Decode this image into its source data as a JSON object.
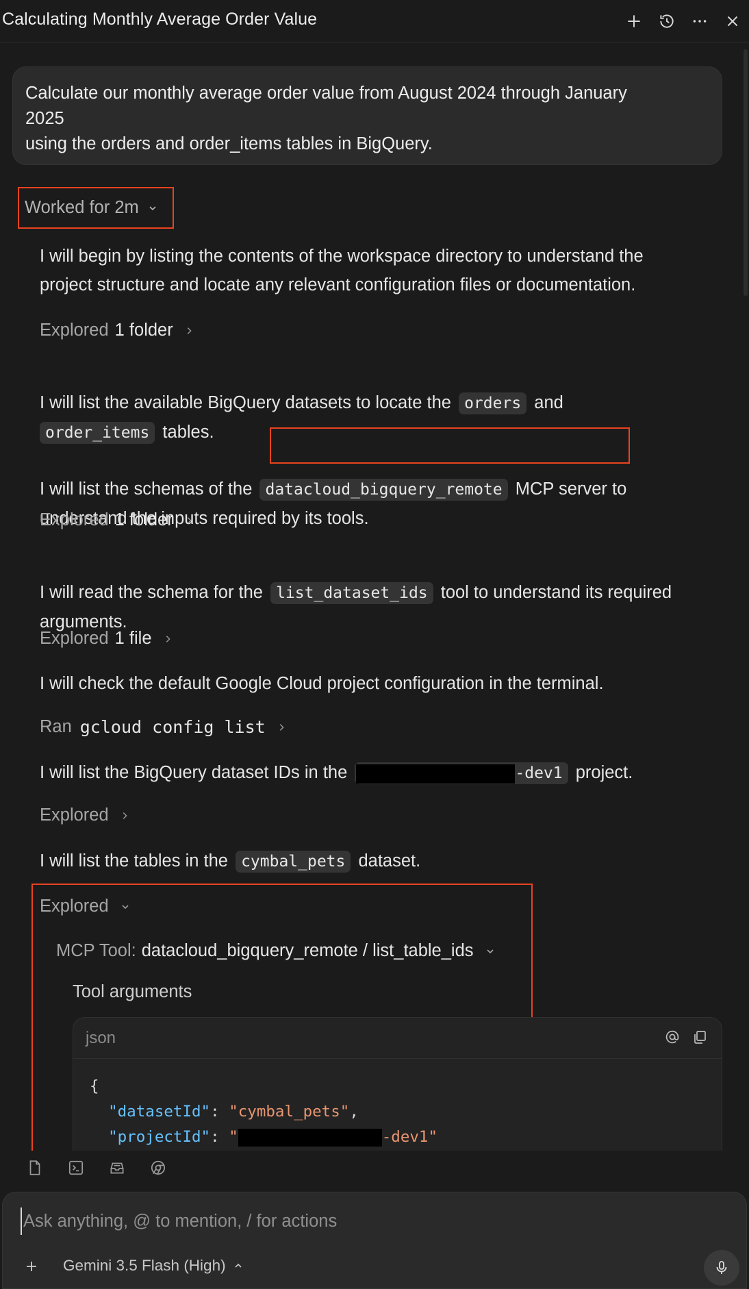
{
  "header": {
    "title": "Calculating Monthly Average Order Value",
    "actions": [
      "plus-icon",
      "history-icon",
      "more-icon",
      "close-icon"
    ]
  },
  "user_message": {
    "line1": "Calculate our monthly average order value from August 2024 through January",
    "line2": "2025",
    "line3": "using the orders and order_items tables in BigQuery."
  },
  "worked": {
    "label": "Worked for 2m"
  },
  "steps": {
    "p1_line1": "I will begin by listing the contents of the workspace directory to understand the",
    "p1_line2": "project structure and locate any relevant configuration files or documentation.",
    "explored1_label": "Explored",
    "explored1_value": "1 folder",
    "p2_pre": "I will list the available BigQuery datasets to locate the",
    "p2_code1": "orders",
    "p2_and": "and",
    "p2_code2": "order_items",
    "p2_post": "tables.",
    "p3_pre": "I will list the schemas of the",
    "p3_code": "datacloud_bigquery_remote",
    "p3_mid": "MCP server",
    "p3_post": "to",
    "p3_line2": "understand the inputs required by its tools.",
    "explored2_label": "Explored",
    "explored2_value": "1 folder",
    "p4_pre": "I will read the schema for the",
    "p4_code": "list_dataset_ids",
    "p4_post": "tool to understand its required",
    "p4_line2": "arguments.",
    "explored3_label": "Explored",
    "explored3_value": "1 file",
    "p5": "I will check the default Google Cloud project configuration in the terminal.",
    "ran_label": "Ran",
    "ran_command": "gcloud config list",
    "p6_pre": "I will list the BigQuery dataset IDs in the",
    "p6_code_suffix": "-dev1",
    "p6_post": "project.",
    "explored4_label": "Explored",
    "p7_pre": "I will list the tables in the",
    "p7_code": "cymbal_pets",
    "p7_post": "dataset.",
    "explored5_label": "Explored"
  },
  "mcp": {
    "label": "MCP Tool:",
    "value": "datacloud_bigquery_remote / list_table_ids",
    "tool_args_label": "Tool arguments"
  },
  "code": {
    "lang": "json",
    "brace_open": "{",
    "key1": "\"datasetId\"",
    "val1": "\"cymbal_pets\"",
    "key2": "\"projectId\"",
    "val2_prefix": "\"",
    "val2_suffix": "-dev1\""
  },
  "composer": {
    "placeholder": "Ask anything, @ to mention, / for actions",
    "model": "Gemini 3.5 Flash (High)"
  },
  "colors": {
    "background": "#1b1b1b",
    "highlight_box": "#e8431f",
    "json_key": "#66c2ff",
    "json_string": "#e89570"
  }
}
